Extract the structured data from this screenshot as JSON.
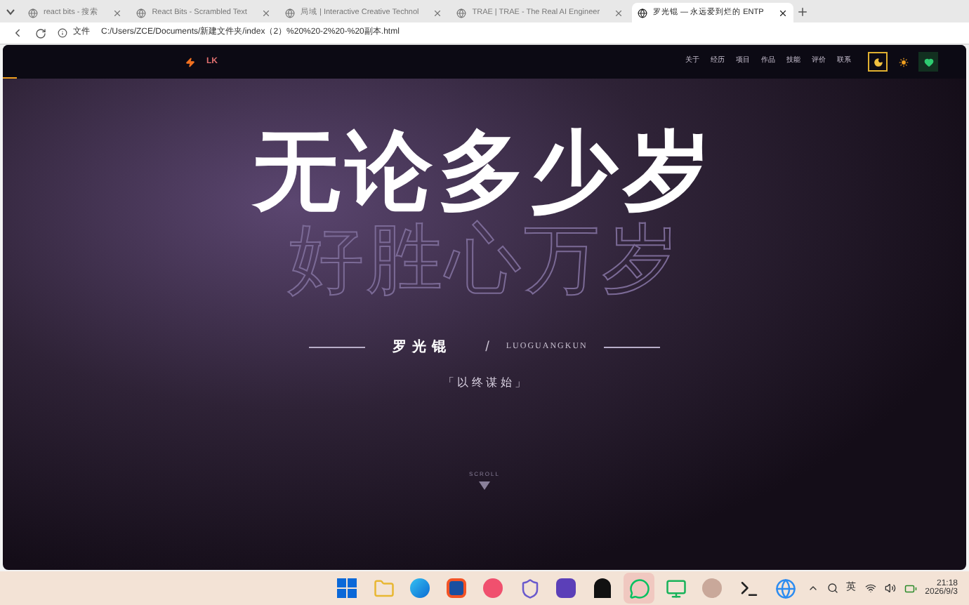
{
  "browser": {
    "tabs": [
      {
        "label": "react bits - 搜索",
        "selected": false
      },
      {
        "label": "React Bits - Scrambled Text",
        "selected": false
      },
      {
        "label": "局域 | Interactive Creative Technol",
        "selected": false
      },
      {
        "label": "TRAE | TRAE - The Real AI Engineer",
        "selected": false
      },
      {
        "label": "罗光锟 — 永远爱到烂的 ENTP",
        "selected": true
      }
    ],
    "address": {
      "prefix": "文件",
      "url": "C:/Users/ZCE/Documents/新建文件夹/index（2）%20%20-2%20-%20副本.html"
    }
  },
  "page": {
    "nav": {
      "logo": "LK",
      "links": [
        {
          "label": "关于"
        },
        {
          "label": "经历"
        },
        {
          "label": "项目"
        },
        {
          "label": "作品"
        },
        {
          "label": "技能"
        },
        {
          "label": "评价"
        },
        {
          "label": "联系"
        }
      ],
      "toggles": [
        {
          "kind": "moon",
          "selected": true
        },
        {
          "kind": "sun",
          "selected": false
        },
        {
          "kind": "heart",
          "selected": false
        }
      ],
      "progress": {
        "level": 0.015
      }
    },
    "hero": {
      "title": "无论多少岁",
      "subtitle": "好胜心万岁",
      "name": "罗光锟",
      "separator": "/",
      "name_latin": "LUOGUANGKUN",
      "motto": "「 以 终 谋 始 」",
      "scroll": "SCROLL"
    }
  },
  "taskbar": {
    "apps": [
      {
        "kind": "start"
      },
      {
        "kind": "folder"
      },
      {
        "kind": "edge"
      },
      {
        "kind": "store"
      },
      {
        "kind": "red"
      },
      {
        "kind": "shield"
      },
      {
        "kind": "purple"
      },
      {
        "kind": "penguin"
      },
      {
        "kind": "chat",
        "selected": true
      },
      {
        "kind": "green"
      },
      {
        "kind": "avatar"
      },
      {
        "kind": "terminal"
      },
      {
        "kind": "blue"
      }
    ],
    "tray": {
      "ime": "英",
      "time": "21:18",
      "date": "2026/9/3"
    }
  }
}
